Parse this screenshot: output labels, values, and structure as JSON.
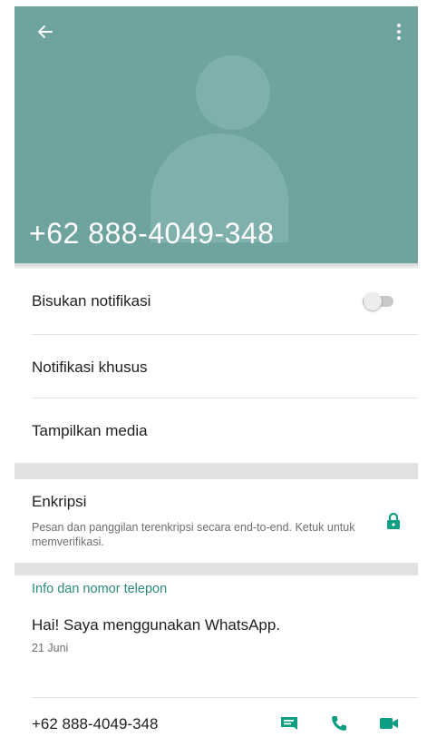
{
  "header": {
    "title": "+62 888-4049-348",
    "back_icon": "arrow-left-icon",
    "menu_icon": "more-vert-icon",
    "avatar": "default-contact-avatar"
  },
  "settings": {
    "mute_label": "Bisukan notifikasi",
    "mute_enabled": false,
    "custom_notifications_label": "Notifikasi khusus",
    "media_label": "Tampilkan media"
  },
  "encryption": {
    "title": "Enkripsi",
    "description": "Pesan dan panggilan terenkripsi secara end-to-end. Ketuk untuk memverifikasi.",
    "icon": "lock-icon"
  },
  "info": {
    "heading": "Info dan nomor telepon",
    "status": "Hai! Saya menggunakan WhatsApp.",
    "date": "21 Juni",
    "phone": "+62 888-4049-348",
    "actions": [
      "message-icon",
      "call-icon",
      "video-call-icon"
    ]
  },
  "colors": {
    "header_bg": "#6fa39e",
    "accent": "#2b8a79",
    "icon_teal": "#0f9d83"
  }
}
